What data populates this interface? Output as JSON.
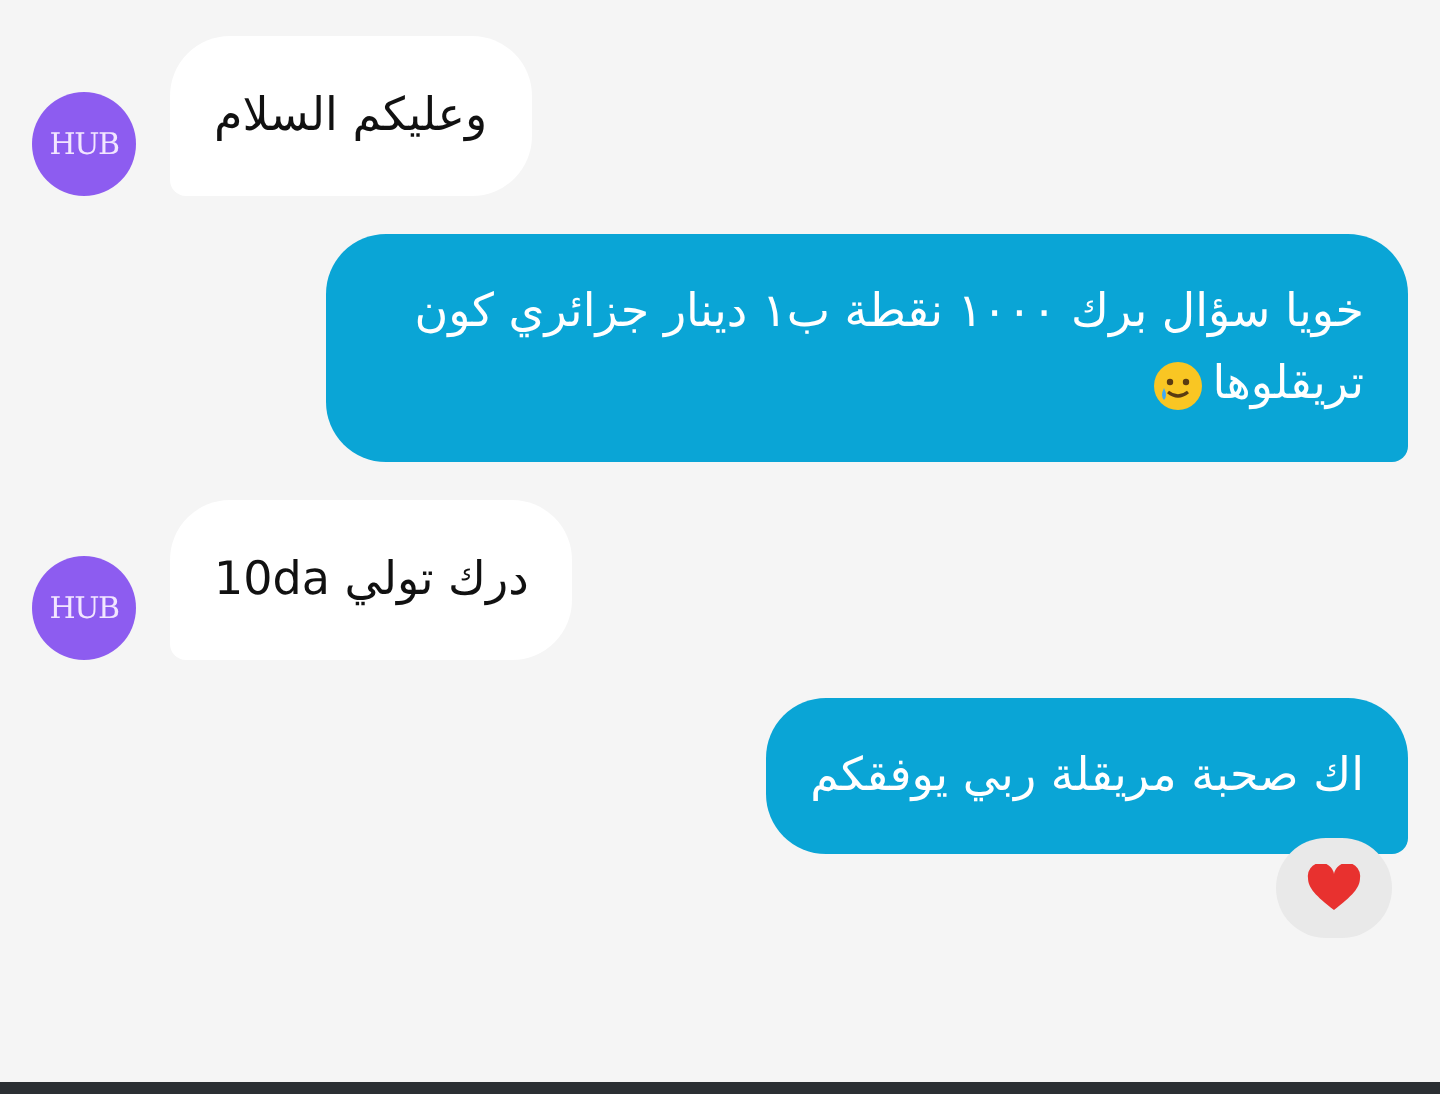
{
  "messages": [
    {
      "kind": "incoming",
      "avatar": "HUB",
      "text": "وعليكم السلام"
    },
    {
      "kind": "outgoing",
      "text": "خويا سؤال برك ١٠٠٠ نقطة ب١ دينار جزائري كون تريقلوها",
      "emoji": {
        "kind": "smiling-tear"
      }
    },
    {
      "kind": "incoming",
      "avatar": "HUB",
      "text": "درك تولي 10da"
    },
    {
      "kind": "outgoing",
      "text": "اك صحبة مريقلة ربي يوفقكم",
      "reaction": {
        "kind": "heart"
      }
    }
  ]
}
